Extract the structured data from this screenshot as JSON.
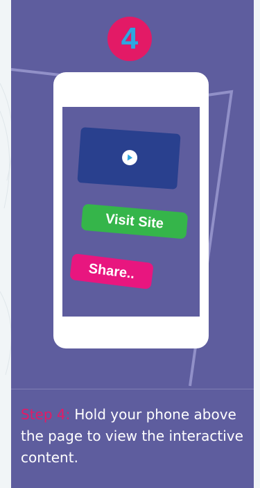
{
  "step_number": "4",
  "phone": {
    "visit_label": "Visit Site",
    "share_label": "Share.."
  },
  "instruction": {
    "step_label": "Step 4:",
    "text": "Hold your phone above the page to view the interactive content."
  },
  "colors": {
    "card_background": "#5e5d9e",
    "page_background": "#f1f5f7",
    "step_accent": "#e31a66",
    "step_number": "#2ea6e0",
    "video_block": "#29408e",
    "visit_button": "#35b54a",
    "share_button": "#e8167f",
    "play_arrow": "#2ea6e0"
  },
  "icons": {
    "play": "play-icon"
  }
}
